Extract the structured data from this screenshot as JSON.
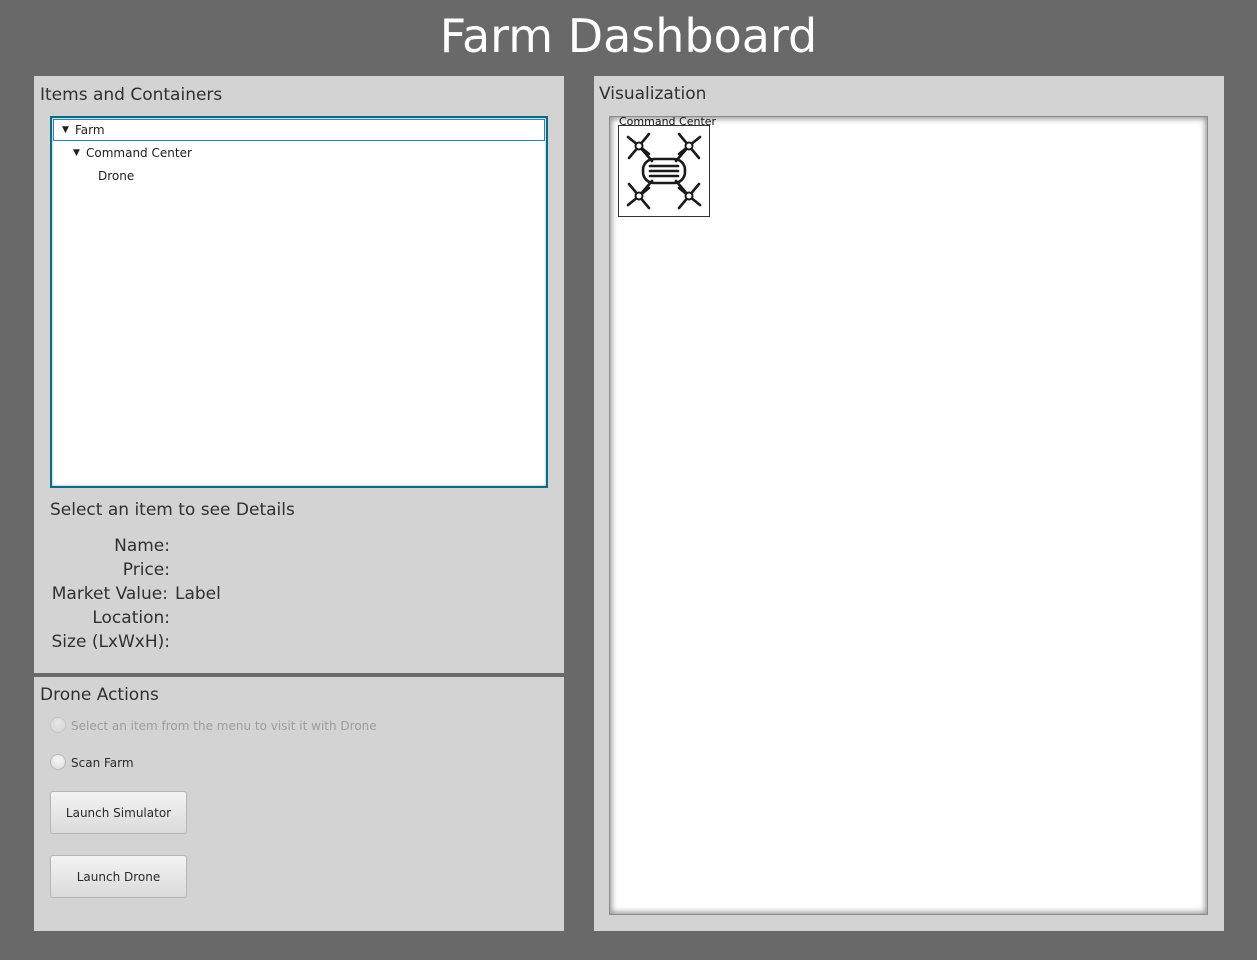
{
  "app": {
    "title": "Farm Dashboard"
  },
  "left_panel": {
    "title": "Items and Containers",
    "tree": [
      {
        "label": "Farm",
        "expanded": true,
        "selected": true,
        "depth": 0
      },
      {
        "label": "Command Center",
        "expanded": true,
        "selected": false,
        "depth": 1
      },
      {
        "label": "Drone",
        "expanded": false,
        "selected": false,
        "depth": 2
      }
    ],
    "details": {
      "heading": "Select an item to see Details",
      "name_label": "Name:",
      "name_value": "",
      "price_label": "Price:",
      "price_value": "",
      "market_value_label": "Market Value:",
      "market_value_value": "Label",
      "location_label": "Location:",
      "location_value": "",
      "size_label": "Size (LxWxH):",
      "size_value": ""
    }
  },
  "drone_actions": {
    "title": "Drone Actions",
    "visit_option": "Select an item from the menu to visit it with Drone",
    "scan_option": "Scan Farm",
    "launch_simulator": "Launch Simulator",
    "launch_drone": "Launch Drone"
  },
  "visualization": {
    "title": "Visualization",
    "container_label": "Command Center",
    "item_icon": "drone-icon"
  },
  "colors": {
    "background": "#696969",
    "panel": "#d3d3d3",
    "tree_border": "#0f6a85",
    "selection_border": "#2c86b7"
  }
}
